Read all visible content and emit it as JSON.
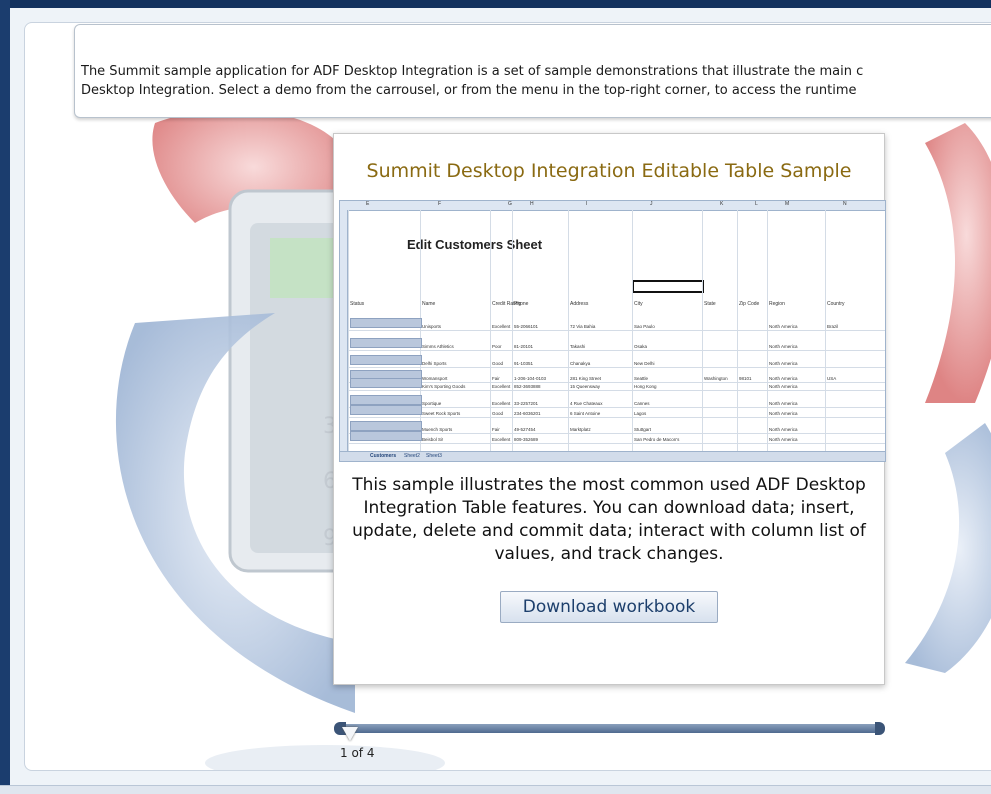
{
  "intro": {
    "text": "The Summit sample application for ADF Desktop Integration is a set of sample demonstrations that illustrate the main c\nDesktop Integration. Select a demo from the carrousel, or from the menu in the top-right corner, to access the runtime"
  },
  "card": {
    "title": "Summit Desktop Integration Editable Table Sample",
    "description": "This sample illustrates the most common used ADF Desktop Integration Table features. You can download data; insert, update, delete and commit data; interact with column list of values, and track changes.",
    "button_label": "Download workbook"
  },
  "sheet": {
    "title": "Edit Customers Sheet",
    "columns": [
      "E",
      "F",
      "G",
      "H",
      "I",
      "J",
      "K",
      "L",
      "M",
      "N"
    ],
    "headers": [
      "Status",
      "Name",
      "Credit Rating",
      "Phone",
      "Address",
      "City",
      "State",
      "Zip Code",
      "Region",
      "Country"
    ],
    "rows": [
      [
        "Unisports",
        "Excellent",
        "55-2066101",
        "72 Via Bahia",
        "Sao Paulo",
        "",
        "",
        "North America",
        "Brazil"
      ],
      [
        "Simms Athletics",
        "Poor",
        "81-20101",
        "Takashi",
        "Osaka",
        "",
        "",
        "North America",
        ""
      ],
      [
        "Delhi Sports",
        "Good",
        "91-10351",
        "Chanakya",
        "New Delhi",
        "",
        "",
        "North America",
        ""
      ],
      [
        "Womansport",
        "Fair",
        "1-206-104-0103",
        "281 King Street",
        "Seattle",
        "Washington",
        "98101",
        "North America",
        "USA"
      ],
      [
        "Kim's Sporting Goods",
        "Excellent",
        "852-3693888",
        "15 Queensway",
        "Hong Kong",
        "",
        "",
        "North America",
        ""
      ],
      [
        "Sportique",
        "Excellent",
        "33-2257201",
        "4 Rue Chateaux",
        "Cannes",
        "",
        "",
        "North America",
        ""
      ],
      [
        "Sweet Rock Sports",
        "Good",
        "234-6036201",
        "6 Saint Antoine",
        "Lagos",
        "",
        "",
        "North America",
        ""
      ],
      [
        "Muench Sports",
        "Fair",
        "49-527454",
        "Marktplatz",
        "Stuttgart",
        "",
        "",
        "North America",
        ""
      ],
      [
        "Beisbol Si!",
        "Excellent",
        "809-352689",
        "",
        "San Pedro de Macon's",
        "",
        "",
        "North America",
        ""
      ]
    ],
    "tabs": [
      "Customers",
      "Sheet2",
      "Sheet3"
    ]
  },
  "carousel": {
    "page_indicator": "1 of 4",
    "current_page": 1,
    "total_pages": 4
  },
  "colors": {
    "frame": "#12315e",
    "title": "#8a6a12",
    "button_text": "#1d3f6c"
  }
}
